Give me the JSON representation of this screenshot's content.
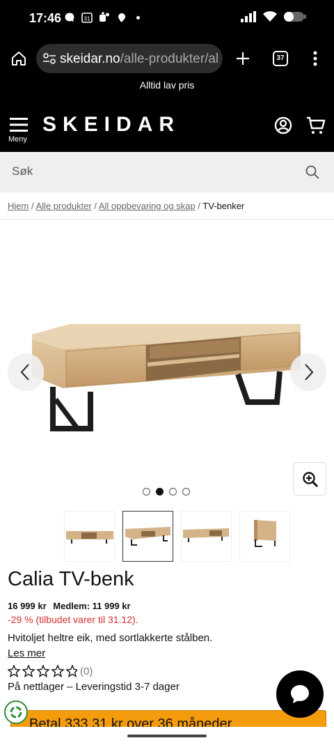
{
  "status_bar": {
    "time": "17:46",
    "calendar_day": "31"
  },
  "browser": {
    "url_domain": "skeidar.no",
    "url_path": "/alle-produkter/al",
    "tab_count": "37"
  },
  "promo": {
    "text": "Alltid lav pris"
  },
  "header": {
    "logo": "SKEIDAR",
    "menu_label": "Meny"
  },
  "search": {
    "placeholder": "Søk"
  },
  "breadcrumb": {
    "items": [
      "Hjem",
      "Alle produkter",
      "All oppbevaring og skap"
    ],
    "current": "TV-benker",
    "separator": "/"
  },
  "gallery": {
    "active_index": 1,
    "image_count": 4
  },
  "product": {
    "title": "Calia TV-benk",
    "price": "16 999 kr",
    "member_price": "Medlem: 11 999 kr",
    "discount": "-29 % (tilbudet varer til 31.12).",
    "description": "Hvitoljet heltre eik, med sortlakkerte stålben.",
    "read_more": "Les mer",
    "rating_count": "(0)",
    "stars": 0,
    "stock": "På nettlager – Leveringstid 3-7 dager"
  },
  "cta": {
    "label": "Betal 333,31 kr over 36 måneder"
  },
  "colors": {
    "accent": "#f59b0e",
    "discount": "#d32f2f",
    "header_bg": "#000000"
  }
}
